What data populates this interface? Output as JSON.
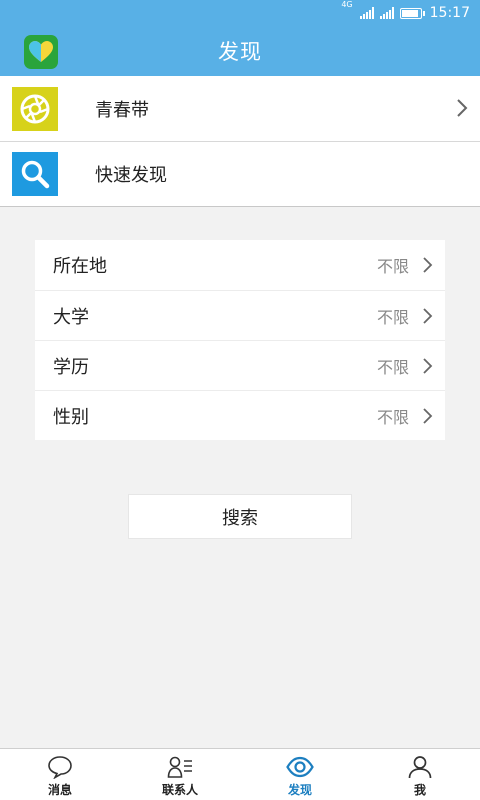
{
  "status_bar": {
    "network": "4G",
    "time": "15:17",
    "battery_level": 0.9
  },
  "header": {
    "title": "发现",
    "logo_icon": "heart-logo-icon"
  },
  "entries": [
    {
      "label": "青春带",
      "icon": "aperture-icon",
      "icon_bg": "#d7d21a",
      "has_chevron": true
    },
    {
      "label": "快速发现",
      "icon": "search-icon",
      "icon_bg": "#1e9ae0",
      "has_chevron": false
    }
  ],
  "filters": [
    {
      "label": "所在地",
      "value": "不限"
    },
    {
      "label": "大学",
      "value": "不限"
    },
    {
      "label": "学历",
      "value": "不限"
    },
    {
      "label": "性别",
      "value": "不限"
    }
  ],
  "search_button": {
    "label": "搜索"
  },
  "tabs": [
    {
      "label": "消息",
      "icon": "chat-bubble-icon",
      "active": false
    },
    {
      "label": "联系人",
      "icon": "contacts-icon",
      "active": false
    },
    {
      "label": "发现",
      "icon": "eye-icon",
      "active": true
    },
    {
      "label": "我",
      "icon": "person-icon",
      "active": false
    }
  ],
  "colors": {
    "primary": "#58b0e6",
    "active_tab": "#1d7fc0",
    "background": "#f2f2f2"
  }
}
